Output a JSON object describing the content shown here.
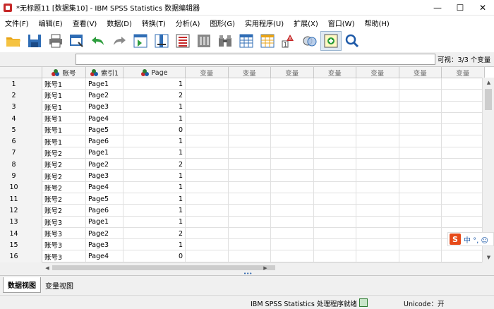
{
  "window": {
    "title": "*无标题11 [数据集10] - IBM SPSS Statistics 数据编辑器",
    "minimize": "—",
    "maximize": "☐",
    "close": "✕"
  },
  "menu": [
    "文件(F)",
    "编辑(E)",
    "查看(V)",
    "数据(D)",
    "转换(T)",
    "分析(A)",
    "图形(G)",
    "实用程序(U)",
    "扩展(X)",
    "窗口(W)",
    "帮助(H)"
  ],
  "editbar": {
    "visible": "可视：3/3 个变量"
  },
  "grid": {
    "columns": [
      "账号",
      "索引1",
      "Page"
    ],
    "empty_column_label": "变量",
    "rows": [
      [
        "1",
        "账号1",
        "Page1",
        "1"
      ],
      [
        "2",
        "账号1",
        "Page2",
        "2"
      ],
      [
        "3",
        "账号1",
        "Page3",
        "1"
      ],
      [
        "4",
        "账号1",
        "Page4",
        "1"
      ],
      [
        "5",
        "账号1",
        "Page5",
        "0"
      ],
      [
        "6",
        "账号1",
        "Page6",
        "1"
      ],
      [
        "7",
        "账号2",
        "Page1",
        "1"
      ],
      [
        "8",
        "账号2",
        "Page2",
        "2"
      ],
      [
        "9",
        "账号2",
        "Page3",
        "1"
      ],
      [
        "10",
        "账号2",
        "Page4",
        "1"
      ],
      [
        "11",
        "账号2",
        "Page5",
        "1"
      ],
      [
        "12",
        "账号2",
        "Page6",
        "1"
      ],
      [
        "13",
        "账号3",
        "Page1",
        "1"
      ],
      [
        "14",
        "账号3",
        "Page2",
        "2"
      ],
      [
        "15",
        "账号3",
        "Page3",
        "1"
      ],
      [
        "16",
        "账号3",
        "Page4",
        "0"
      ]
    ]
  },
  "tabs": {
    "data_view": "数据视图",
    "variable_view": "变量视图"
  },
  "status": {
    "processor": "IBM SPSS Statistics 处理程序就绪",
    "unicode": "Unicode：开"
  },
  "ime": {
    "logo": "S",
    "text": "中 °, ☺"
  },
  "colors": {
    "nominal_red": "#c62828",
    "nominal_blue": "#1e5aa8",
    "nominal_green": "#2e7d32"
  }
}
